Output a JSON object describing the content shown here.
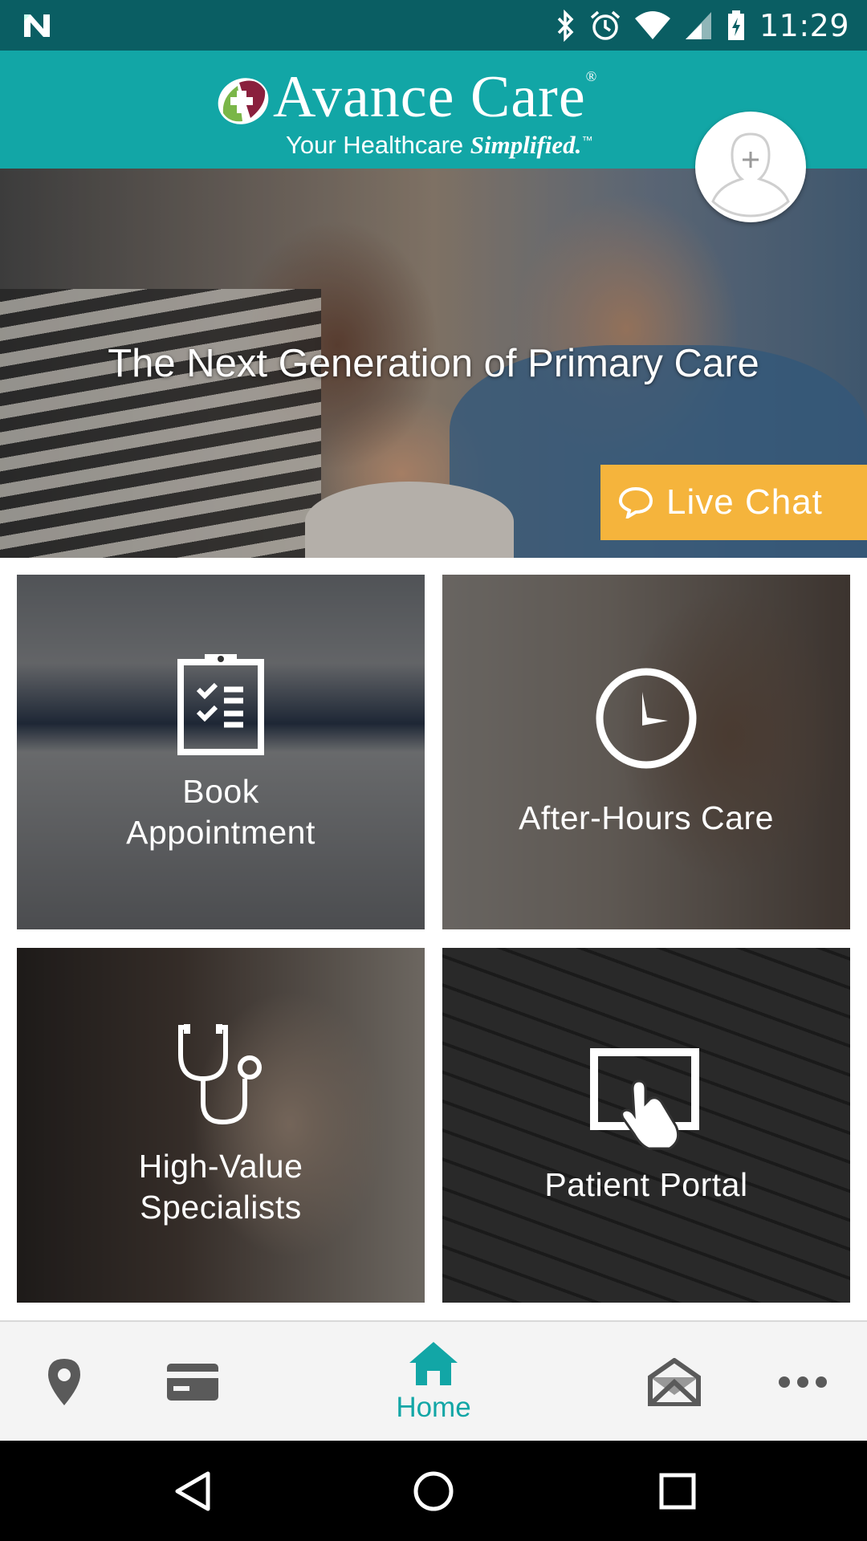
{
  "status_bar": {
    "time": "11:29"
  },
  "header": {
    "brand": "Avance Care",
    "registered_mark": "®",
    "tagline_regular": "Your Healthcare",
    "tagline_bold": "Simplified.",
    "trademark": "™"
  },
  "hero": {
    "title": "The Next Generation of Primary Care",
    "live_chat_label": "Live Chat"
  },
  "tiles": [
    {
      "label": "Book Appointment",
      "icon": "clipboard-checklist-icon"
    },
    {
      "label": "After-Hours Care",
      "icon": "clock-icon"
    },
    {
      "label": "High-Value Specialists",
      "icon": "stethoscope-icon"
    },
    {
      "label": "Patient Portal",
      "icon": "tablet-touch-icon"
    }
  ],
  "bottom_nav": {
    "items": [
      {
        "icon": "location-pin-icon",
        "label": ""
      },
      {
        "icon": "credit-card-icon",
        "label": ""
      },
      {
        "icon": "home-icon",
        "label": "Home"
      },
      {
        "icon": "mail-open-icon",
        "label": ""
      },
      {
        "icon": "more-dots-icon",
        "label": ""
      }
    ],
    "active_color": "#12a6a6",
    "inactive_color": "#5a5a5a"
  },
  "colors": {
    "status_bar": "#0a5e63",
    "header": "#12a6a6",
    "live_chat": "#f5b43c"
  }
}
